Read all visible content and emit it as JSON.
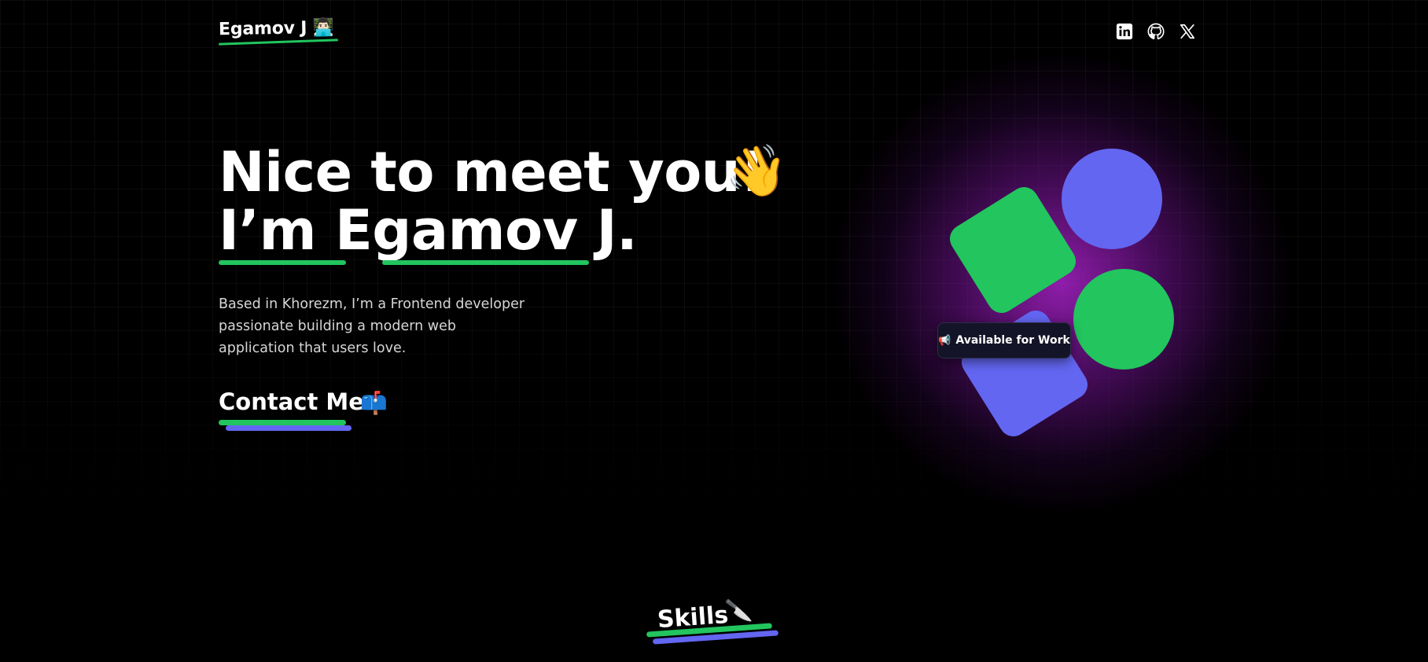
{
  "header": {
    "logo_text": "Egamov J 👨🏻‍💻",
    "social": [
      {
        "name": "LinkedIn",
        "icon": "linkedin-icon"
      },
      {
        "name": "GitHub",
        "icon": "github-icon"
      },
      {
        "name": "X",
        "icon": "x-icon"
      }
    ]
  },
  "hero": {
    "title_line_1": "Nice to meet you!",
    "title_line_2": "I’m Egamov J.",
    "wave_emoji": "👋",
    "description": "Based in Khorezm, I’m a Frontend developer passionate building a modern web application that users love.",
    "cta_label": "Contact Me",
    "cta_emoji": "📫"
  },
  "art": {
    "badge_icon": "📢",
    "badge_label": "Available for Work"
  },
  "skills": {
    "title": "Skills",
    "emoji": "🔪"
  },
  "colors": {
    "background": "#000000",
    "accent_green": "#22c55e",
    "accent_indigo": "#6366f1",
    "glow_purple": "#a822c8"
  }
}
